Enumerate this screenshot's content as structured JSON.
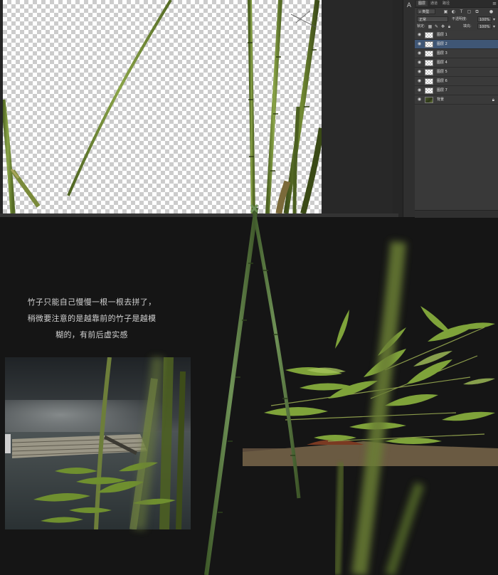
{
  "photoshop": {
    "panel_tabs": [
      "图层",
      "通道",
      "路径"
    ],
    "filter_kind": "类型",
    "blend_mode": "正常",
    "opacity_label": "不透明度:",
    "opacity_value": "100%",
    "lock_label": "锁定:",
    "fill_label": "填充:",
    "fill_value": "100%",
    "layers": [
      {
        "name": "图层 1",
        "selected": false
      },
      {
        "name": "图层 2",
        "selected": true
      },
      {
        "name": "图层 3",
        "selected": false
      },
      {
        "name": "图层 4",
        "selected": false
      },
      {
        "name": "图层 5",
        "selected": false
      },
      {
        "name": "图层 6",
        "selected": false
      },
      {
        "name": "图层 7",
        "selected": false
      },
      {
        "name": "背景",
        "selected": false,
        "locked": true
      }
    ],
    "icons": [
      "eye-icon",
      "lock-icon",
      "layer-thumbnail",
      "panel-menu-icon",
      "character-icon"
    ]
  },
  "caption": {
    "lines": [
      "竹子只能自己慢慢一根一根去拼了，",
      "稍微要注意的是越靠前的竹子是越模",
      "糊的，有前后虚实感"
    ]
  },
  "colors": {
    "background": "#151515",
    "panel": "#393939",
    "selected_layer": "#3f5675",
    "bamboo_green": "#6f8a3a",
    "caption_text": "#d0d0d0"
  }
}
